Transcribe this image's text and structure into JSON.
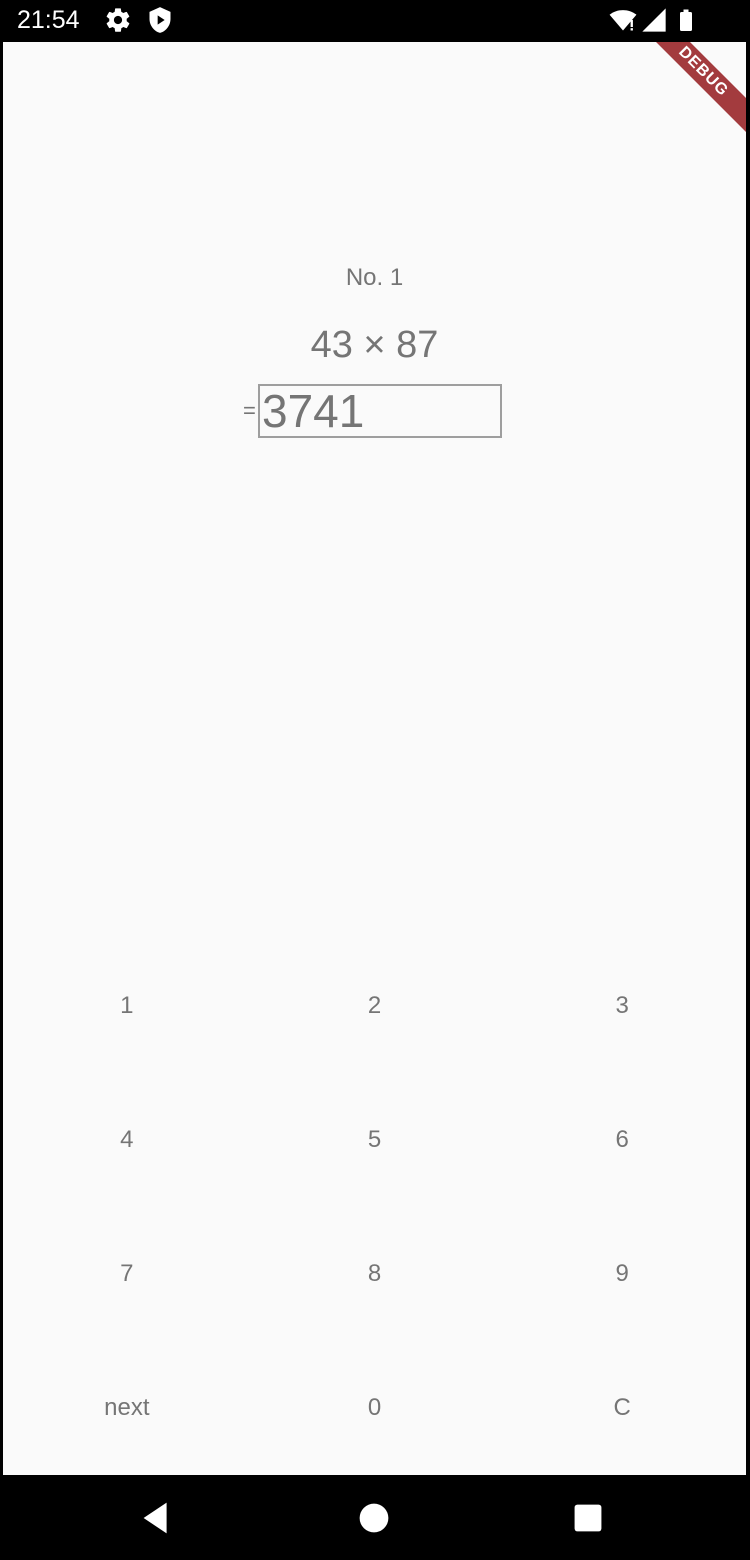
{
  "status_bar": {
    "time": "21:54",
    "icons": [
      "settings-icon",
      "shield-play-icon",
      "wifi-icon",
      "cell-signal-icon",
      "battery-icon"
    ]
  },
  "debug_banner": "DEBUG",
  "quiz": {
    "problem_label": "No. 1",
    "equation": "43 × 87",
    "equals_sign": "=",
    "answer_value": "3741"
  },
  "keypad": {
    "rows": [
      [
        "1",
        "2",
        "3"
      ],
      [
        "4",
        "5",
        "6"
      ],
      [
        "7",
        "8",
        "9"
      ],
      [
        "next",
        "0",
        "C"
      ]
    ]
  },
  "nav_bar": {
    "icons": [
      "back-icon",
      "home-icon",
      "recents-icon"
    ]
  },
  "colors": {
    "background": "#fafafa",
    "text": "#757575",
    "border": "#9e9e9e",
    "debug_ribbon": "#a33b3e"
  }
}
